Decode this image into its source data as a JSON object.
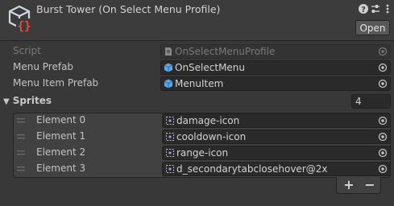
{
  "header": {
    "title": "Burst Tower (On Select Menu Profile)",
    "script_icon": "csharp-script-icon",
    "actions": [
      {
        "name": "help-icon",
        "glyph": "?"
      },
      {
        "name": "presets-icon",
        "glyph": "sliders"
      },
      {
        "name": "more-menu-icon",
        "glyph": "⋮"
      }
    ],
    "open_label": "Open"
  },
  "fields": {
    "script": {
      "label": "Script",
      "value": "OnSelectMenuProfile",
      "icon": "script-file-icon"
    },
    "menu_prefab": {
      "label": "Menu Prefab",
      "value": "OnSelectMenu",
      "icon": "prefab-icon"
    },
    "menu_item_prefab": {
      "label": "Menu Item Prefab",
      "value": "MenuItem",
      "icon": "prefab-icon"
    }
  },
  "sprites": {
    "label": "Sprites",
    "expanded": true,
    "count": "4",
    "elements": [
      {
        "label": "Element 0",
        "value": "damage-icon"
      },
      {
        "label": "Element 1",
        "value": "cooldown-icon"
      },
      {
        "label": "Element 2",
        "value": "range-icon"
      },
      {
        "label": "Element 3",
        "value": "d_secondarytabclosehover@2x"
      }
    ],
    "add_label": "+",
    "remove_label": "−"
  },
  "colors": {
    "background": "#383838",
    "header": "#3c3c3c",
    "field": "#2a2a2a",
    "prefab_icon": "#5aa8e8"
  }
}
